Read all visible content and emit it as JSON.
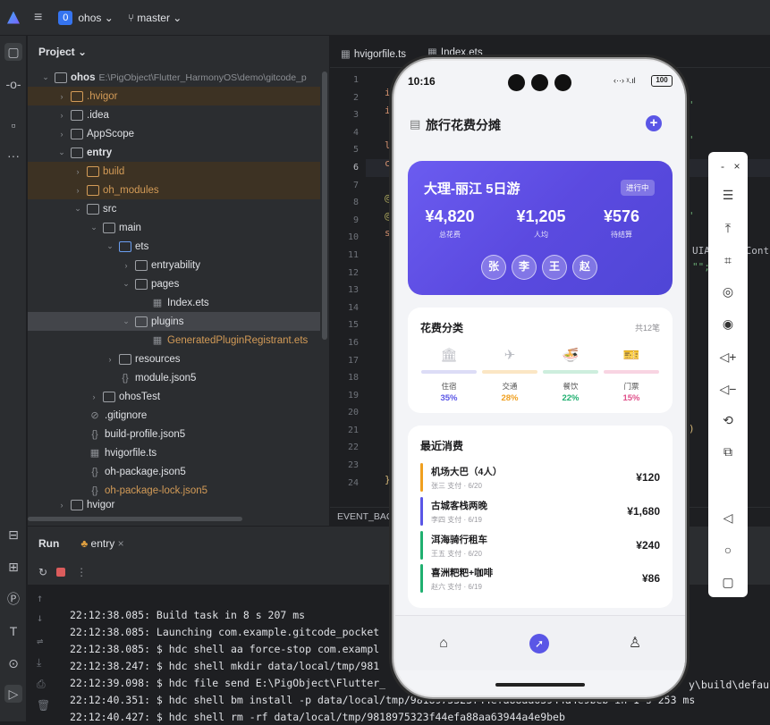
{
  "topbar": {
    "project_badge": "0",
    "project_name": "ohos ⌄",
    "branch": "⑂ master ⌄"
  },
  "project_panel": {
    "title": "Project ⌄",
    "tree": [
      {
        "label": "ohos",
        "path": "E:\\PigObject\\Flutter_HarmonyOS\\demo\\gitcode_p"
      },
      {
        "label": ".hvigor"
      },
      {
        "label": ".idea"
      },
      {
        "label": "AppScope"
      },
      {
        "label": "entry"
      },
      {
        "label": "build"
      },
      {
        "label": "oh_modules"
      },
      {
        "label": "src"
      },
      {
        "label": "main"
      },
      {
        "label": "ets"
      },
      {
        "label": "entryability"
      },
      {
        "label": "pages"
      },
      {
        "label": "Index.ets"
      },
      {
        "label": "plugins"
      },
      {
        "label": "GeneratedPluginRegistrant.ets"
      },
      {
        "label": "resources"
      },
      {
        "label": "module.json5"
      },
      {
        "label": "ohosTest"
      },
      {
        "label": ".gitignore"
      },
      {
        "label": "build-profile.json5"
      },
      {
        "label": "hvigorfile.ts"
      },
      {
        "label": "oh-package.json5"
      },
      {
        "label": "oh-package-lock.json5"
      },
      {
        "label": "hvigor"
      }
    ]
  },
  "editor": {
    "tabs": [
      "hvigorfile.ts",
      "Index.ets"
    ],
    "line_numbers": [
      "1",
      "2",
      "3",
      "4",
      "5",
      "6",
      "7",
      "8",
      "9",
      "10",
      "11",
      "12",
      "13",
      "14",
      "15",
      "16",
      "17",
      "18",
      "19",
      "20",
      "21",
      "22",
      "23",
      "24"
    ],
    "code_right_1": "UIAbilityCont",
    "code_right_2": "\"\";",
    "code_frag_line_2": "i",
    "code_frag_line_3": "i",
    "code_frag_line_5": "l",
    "code_frag_line_6": "c",
    "code_frag_line_8": "@",
    "code_frag_line_9": "@",
    "code_frag_line_10": "s",
    "code_frag_line_24": "}",
    "event_bar": "EVENT_BAC",
    "right_build_path": "y\\build\\defaul"
  },
  "run_panel": {
    "title": "Run",
    "tab": "entry",
    "console": [
      "22:12:38.085: Build task in 8 s 207 ms",
      "22:12:38.085: Launching com.example.gitcode_pocket",
      "22:12:38.085: $ hdc shell aa force-stop com.exampl",
      "22:12:38.247: $ hdc shell mkdir data/local/tmp/981",
      "22:12:39.098: $ hdc file send E:\\PigObject\\Flutter_",
      "22:12:40.351: $ hdc shell bm install -p data/local/tmp/9818975323f44efa88aa63944a4e9beb in 1 s 253 ms",
      "22:12:40.427: $ hdc shell rm -rf data/local/tmp/9818975323f44efa88aa63944a4e9beb"
    ]
  },
  "phone": {
    "time": "10:16",
    "signal": "‹··› ᵡ.ıl",
    "battery": "100",
    "app_title": "旅行花费分摊",
    "trip": {
      "name": "大理-丽江 5日游",
      "status": "进行中",
      "stats": [
        {
          "value": "¥4,820",
          "label": "总花费"
        },
        {
          "value": "¥1,205",
          "label": "人均"
        },
        {
          "value": "¥576",
          "label": "待结算"
        }
      ],
      "members": [
        "张",
        "李",
        "王",
        "赵"
      ]
    },
    "categories": {
      "title": "花费分类",
      "count": "共12笔",
      "items": [
        {
          "icon": "🏛",
          "name": "住宿",
          "percent": "35%",
          "color": "#5a56e6",
          "bar": "#dcdcf6"
        },
        {
          "icon": "✈",
          "name": "交通",
          "percent": "28%",
          "color": "#f0a020",
          "bar": "#fbe6c4"
        },
        {
          "icon": "🍜",
          "name": "餐饮",
          "percent": "22%",
          "color": "#20b070",
          "bar": "#cdeedd"
        },
        {
          "icon": "🎫",
          "name": "门票",
          "percent": "15%",
          "color": "#e0508a",
          "bar": "#f8d4e2"
        }
      ]
    },
    "recent": {
      "title": "最近消费",
      "items": [
        {
          "name": "机场大巴（4人）",
          "meta": "张三 支付 · 6/20",
          "amount": "¥120",
          "color": "#f0a020"
        },
        {
          "name": "古城客栈两晚",
          "meta": "李四 支付 · 6/19",
          "amount": "¥1,680",
          "color": "#5a56e6"
        },
        {
          "name": "洱海骑行租车",
          "meta": "王五 支付 · 6/20",
          "amount": "¥240",
          "color": "#20b070"
        },
        {
          "name": "喜洲粑粑+咖啡",
          "meta": "赵六 支付 · 6/19",
          "amount": "¥86",
          "color": "#20b070"
        }
      ]
    }
  }
}
